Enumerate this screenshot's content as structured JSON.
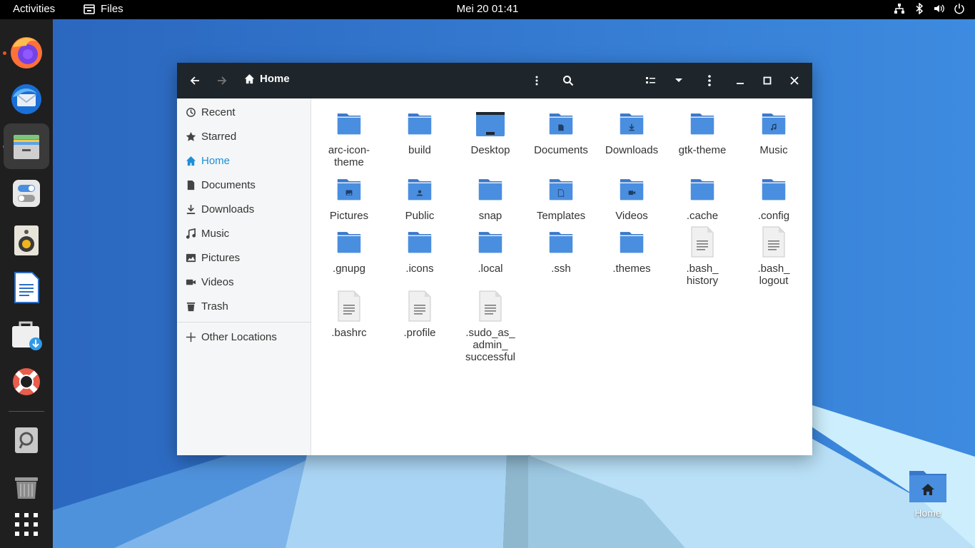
{
  "topbar": {
    "activities": "Activities",
    "app_name": "Files",
    "clock": "Mei 20  01:41",
    "tray_icons": [
      "network-icon",
      "bluetooth-icon",
      "volume-icon",
      "power-icon"
    ]
  },
  "dock": {
    "items": [
      "firefox",
      "thunderbird",
      "files",
      "settings",
      "rhythmbox",
      "libreoffice-writer",
      "software",
      "help",
      "screenshot",
      "trash",
      "show-applications"
    ]
  },
  "window": {
    "location": "Home",
    "sidebar": [
      {
        "label": "Recent",
        "icon": "clock-icon"
      },
      {
        "label": "Starred",
        "icon": "star-icon"
      },
      {
        "label": "Home",
        "icon": "home-icon",
        "active": true
      },
      {
        "label": "Documents",
        "icon": "document-icon"
      },
      {
        "label": "Downloads",
        "icon": "download-icon"
      },
      {
        "label": "Music",
        "icon": "music-icon"
      },
      {
        "label": "Pictures",
        "icon": "picture-icon"
      },
      {
        "label": "Videos",
        "icon": "video-icon"
      },
      {
        "label": "Trash",
        "icon": "trash-icon"
      }
    ],
    "other_locations": "Other Locations",
    "files": [
      {
        "line1": "arc-icon-",
        "line2": "theme",
        "line3": "",
        "kind": "folder"
      },
      {
        "line1": "build",
        "line2": "",
        "line3": "",
        "kind": "folder"
      },
      {
        "line1": "Desktop",
        "line2": "",
        "line3": "",
        "kind": "desktop"
      },
      {
        "line1": "Documents",
        "line2": "",
        "line3": "",
        "kind": "documents"
      },
      {
        "line1": "Downloads",
        "line2": "",
        "line3": "",
        "kind": "downloads"
      },
      {
        "line1": "gtk-theme",
        "line2": "",
        "line3": "",
        "kind": "folder"
      },
      {
        "line1": "Music",
        "line2": "",
        "line3": "",
        "kind": "music"
      },
      {
        "line1": "Pictures",
        "line2": "",
        "line3": "",
        "kind": "pictures"
      },
      {
        "line1": "Public",
        "line2": "",
        "line3": "",
        "kind": "public"
      },
      {
        "line1": "snap",
        "line2": "",
        "line3": "",
        "kind": "folder"
      },
      {
        "line1": "Templates",
        "line2": "",
        "line3": "",
        "kind": "templates"
      },
      {
        "line1": "Videos",
        "line2": "",
        "line3": "",
        "kind": "videos"
      },
      {
        "line1": ".cache",
        "line2": "",
        "line3": "",
        "kind": "folder"
      },
      {
        "line1": ".config",
        "line2": "",
        "line3": "",
        "kind": "folder"
      },
      {
        "line1": ".gnupg",
        "line2": "",
        "line3": "",
        "kind": "folder"
      },
      {
        "line1": ".icons",
        "line2": "",
        "line3": "",
        "kind": "folder"
      },
      {
        "line1": ".local",
        "line2": "",
        "line3": "",
        "kind": "folder"
      },
      {
        "line1": ".ssh",
        "line2": "",
        "line3": "",
        "kind": "folder"
      },
      {
        "line1": ".themes",
        "line2": "",
        "line3": "",
        "kind": "folder"
      },
      {
        "line1": ".bash_",
        "line2": "history",
        "line3": "",
        "kind": "text"
      },
      {
        "line1": ".bash_",
        "line2": "logout",
        "line3": "",
        "kind": "text"
      },
      {
        "line1": ".bashrc",
        "line2": "",
        "line3": "",
        "kind": "text"
      },
      {
        "line1": ".profile",
        "line2": "",
        "line3": "",
        "kind": "text"
      },
      {
        "line1": ".sudo_as_",
        "line2": "admin_",
        "line3": "successful",
        "kind": "text"
      }
    ]
  },
  "desktop": {
    "home_label": "Home"
  },
  "colors": {
    "folder": "#4a8ee0",
    "folder_tab": "#3778cc",
    "accent": "#1e8fd8",
    "headerbar": "#1f262b"
  }
}
